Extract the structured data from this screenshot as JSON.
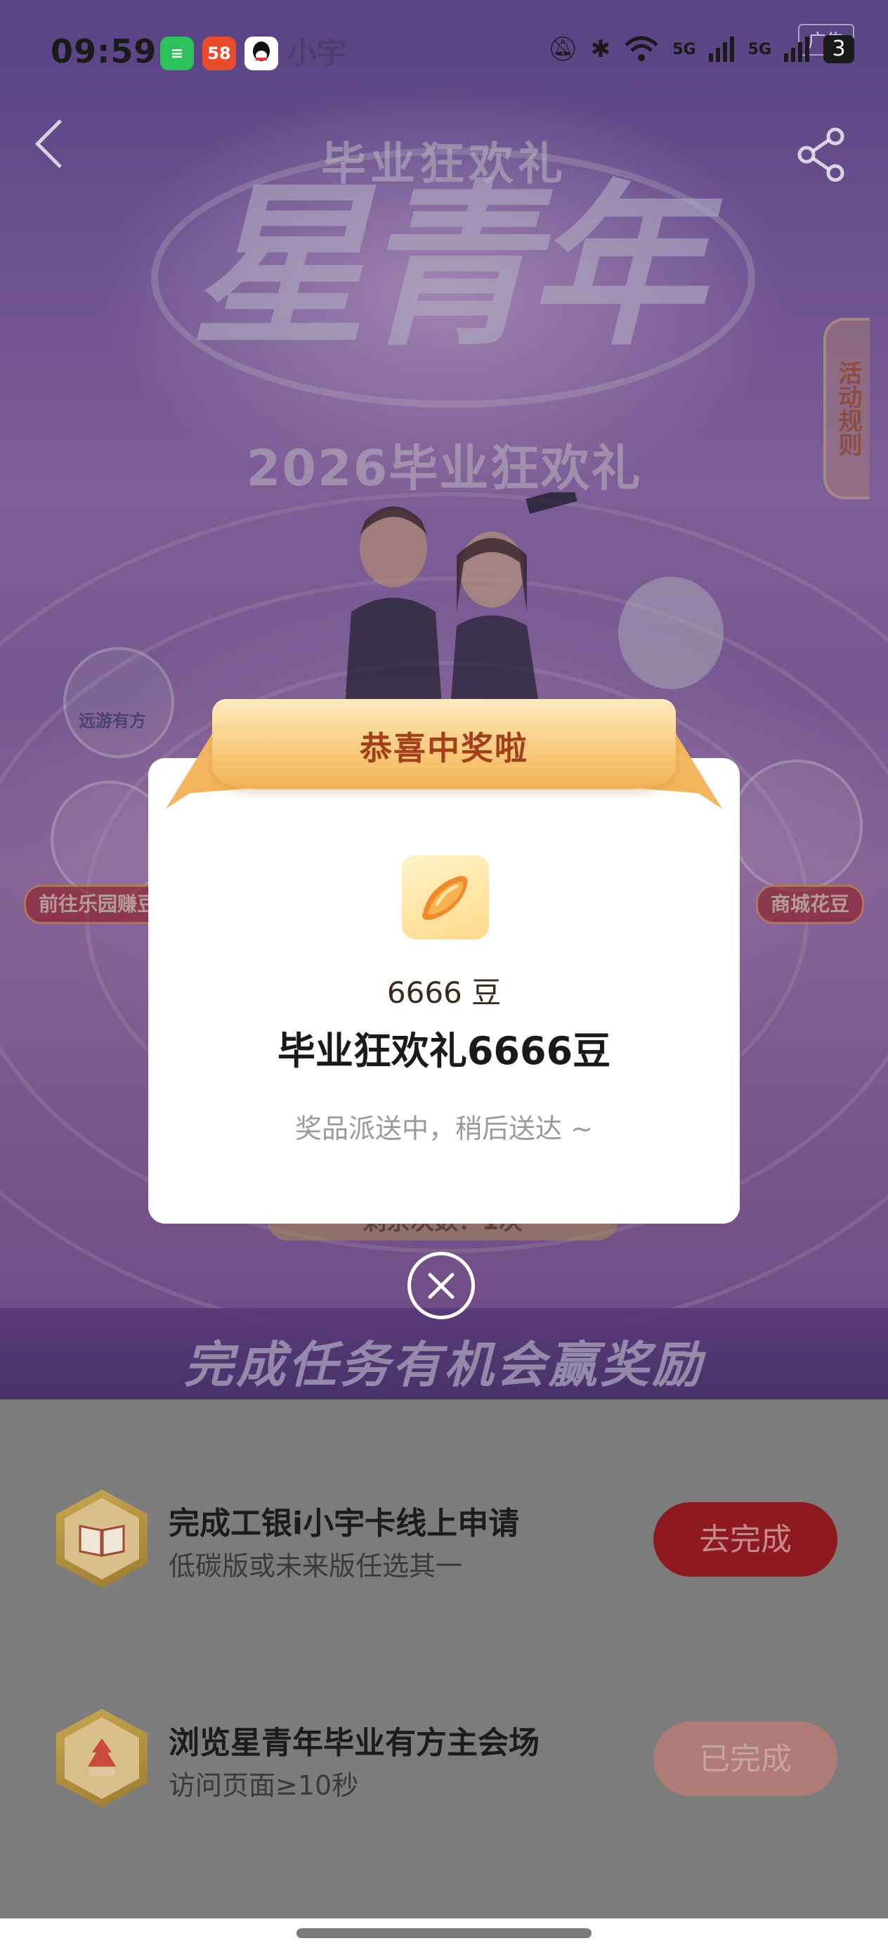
{
  "status_bar": {
    "time": "09:59",
    "apps": [
      "chat-app-icon",
      "58",
      "qq-icon"
    ],
    "network": [
      "5G",
      "5G"
    ],
    "battery": "3"
  },
  "background": {
    "brand_text": "i 小宇",
    "ad_label": "广告",
    "title_small": "毕业狂欢礼",
    "title_big": "星青年",
    "subtitle": "2026毕业狂欢礼",
    "rules_tab": "活动规则",
    "bubble_label": "远游有方",
    "left_pill": "前往乐园赚豆",
    "right_pill": "商城花豆",
    "remaining_partial": "剩余次数：1次",
    "task_banner": "完成任务有机会赢奖励"
  },
  "tasks": [
    {
      "title": "完成工银i小宇卡线上申请",
      "subtitle": "低碳版或未来版任选其一",
      "button": "去完成"
    },
    {
      "title": "浏览星青年毕业有方主会场",
      "subtitle": "访问页面≥10秒",
      "button": "已完成"
    }
  ],
  "modal": {
    "ribbon_title": "恭喜中奖啦",
    "prize_icon": "bean-icon",
    "prize_quantity": "6666 豆",
    "prize_name": "毕业狂欢礼6666豆",
    "note": "奖品派送中，稍后送达 ~"
  },
  "colors": {
    "ribbon": "#f8c97a",
    "ribbon_text": "#a2401c",
    "btn_go": "#8d1a20",
    "btn_done": "#b07a76"
  }
}
